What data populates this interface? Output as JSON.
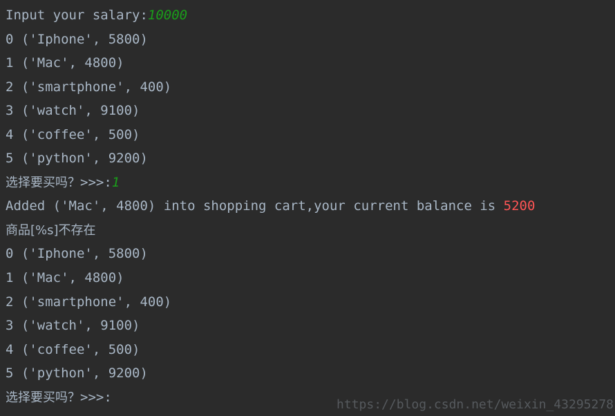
{
  "terminal": {
    "background_color": "#2b2b2b",
    "output_color": "#a9b7c6",
    "input_color": "#1a9e1a",
    "balance_color": "#ff5555",
    "watermark_color": "#565a5e",
    "clipped_top_line": "                                                       ",
    "lines": [
      {
        "id": "salary-prompt",
        "segments": [
          {
            "text": "Input your salary:",
            "style": "out"
          },
          {
            "text": "10000",
            "style": "inp"
          }
        ]
      },
      {
        "id": "product-0-a",
        "segments": [
          {
            "text": "0 ('Iphone', 5800)",
            "style": "out"
          }
        ]
      },
      {
        "id": "product-1-a",
        "segments": [
          {
            "text": "1 ('Mac', 4800)",
            "style": "out"
          }
        ]
      },
      {
        "id": "product-2-a",
        "segments": [
          {
            "text": "2 ('smartphone', 400)",
            "style": "out"
          }
        ]
      },
      {
        "id": "product-3-a",
        "segments": [
          {
            "text": "3 ('watch', 9100)",
            "style": "out"
          }
        ]
      },
      {
        "id": "product-4-a",
        "segments": [
          {
            "text": "4 ('coffee', 500)",
            "style": "out"
          }
        ]
      },
      {
        "id": "product-5-a",
        "segments": [
          {
            "text": "5 ('python', 9200)",
            "style": "out"
          }
        ]
      },
      {
        "id": "buy-prompt-1",
        "segments": [
          {
            "text": "选择要买吗？",
            "style": "out cn"
          },
          {
            "text": ">>>:",
            "style": "out"
          },
          {
            "text": "1",
            "style": "inp"
          }
        ]
      },
      {
        "id": "added-message",
        "segments": [
          {
            "text": "Added ('Mac', 4800) into shopping cart,your current balance is ",
            "style": "out"
          },
          {
            "text": "5200",
            "style": "bal"
          }
        ]
      },
      {
        "id": "not-exist-message",
        "segments": [
          {
            "text": "商品[%s]不存在",
            "style": "out cn"
          }
        ]
      },
      {
        "id": "product-0-b",
        "segments": [
          {
            "text": "0 ('Iphone', 5800)",
            "style": "out"
          }
        ]
      },
      {
        "id": "product-1-b",
        "segments": [
          {
            "text": "1 ('Mac', 4800)",
            "style": "out"
          }
        ]
      },
      {
        "id": "product-2-b",
        "segments": [
          {
            "text": "2 ('smartphone', 400)",
            "style": "out"
          }
        ]
      },
      {
        "id": "product-3-b",
        "segments": [
          {
            "text": "3 ('watch', 9100)",
            "style": "out"
          }
        ]
      },
      {
        "id": "product-4-b",
        "segments": [
          {
            "text": "4 ('coffee', 500)",
            "style": "out"
          }
        ]
      },
      {
        "id": "product-5-b",
        "segments": [
          {
            "text": "5 ('python', 9200)",
            "style": "out"
          }
        ]
      },
      {
        "id": "buy-prompt-2",
        "segments": [
          {
            "text": "选择要买吗？",
            "style": "out cn"
          },
          {
            "text": ">>>:",
            "style": "out"
          }
        ]
      }
    ]
  },
  "watermark": {
    "text": "https://blog.csdn.net/weixin_43295278"
  }
}
